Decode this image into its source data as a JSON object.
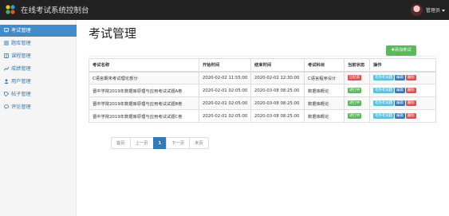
{
  "app": {
    "title": "在线考试系统控制台",
    "user_label": "管理员"
  },
  "sidebar": {
    "items": [
      {
        "label": "考试管理",
        "icon": "monitor-icon",
        "active": true
      },
      {
        "label": "题库管理",
        "icon": "list-icon",
        "active": false
      },
      {
        "label": "课程管理",
        "icon": "book-icon",
        "active": false
      },
      {
        "label": "成绩管理",
        "icon": "chart-icon",
        "active": false
      },
      {
        "label": "用户管理",
        "icon": "user-icon",
        "active": false
      },
      {
        "label": "帖子管理",
        "icon": "tag-icon",
        "active": false
      },
      {
        "label": "评论管理",
        "icon": "comment-icon",
        "active": false
      }
    ]
  },
  "page": {
    "title": "考试管理",
    "add_button": "✚添加考试"
  },
  "table": {
    "headers": [
      "考试名称",
      "开始时间",
      "结束时间",
      "考试科目",
      "当前状态",
      "操作"
    ],
    "rows": [
      {
        "name": "C语言期末考试理论部分",
        "start": "2020-02-02 11:55:00",
        "end": "2020-02-02 12:30:00",
        "subject": "C语言程序设计",
        "status": "已结束",
        "status_color": "#d9534f"
      },
      {
        "name": "晋中学院2019年数据库原理与应用考试试题A卷",
        "start": "2020-02-01 02:05:00",
        "end": "2020-03-08 08:25:00",
        "subject": "数据库概论",
        "status": "进行中",
        "status_color": "#5cb85c"
      },
      {
        "name": "晋中学院2019年数据库原理与应用考试试题B卷",
        "start": "2020-02-01 02:05:00",
        "end": "2020-03-08 08:25:00",
        "subject": "数据库概论",
        "status": "进行中",
        "status_color": "#5cb85c"
      },
      {
        "name": "晋中学院2019年数据库原理与应用考试试题C卷",
        "start": "2020-02-01 02:05:00",
        "end": "2020-03-08 08:25:00",
        "subject": "数据库概论",
        "status": "进行中",
        "status_color": "#5cb85c"
      }
    ],
    "actions": {
      "view": "考务考试题",
      "edit": "编辑",
      "delete": "删除"
    }
  },
  "pagination": {
    "first": "首页",
    "prev": "上一页",
    "current": "1",
    "next": "下一页",
    "last": "末页"
  },
  "colors": {
    "topbar": "#222222",
    "active_nav": "#428bca",
    "success": "#5cb85c",
    "danger": "#d9534f",
    "info": "#5bc0de",
    "primary": "#337ab7"
  }
}
